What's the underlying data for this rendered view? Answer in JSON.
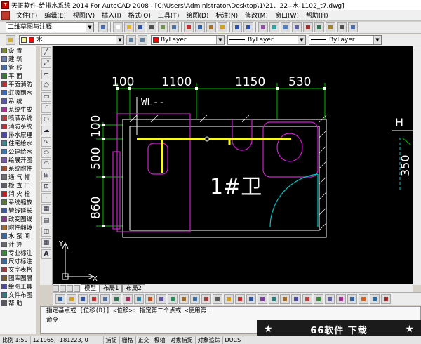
{
  "window": {
    "title": "天正软件-给排水系统 2014 For AutoCAD 2008 - [C:\\Users\\Administrator\\Desktop\\1\\21、22--水-1102_t7.dwg]"
  },
  "menu": [
    "文件(F)",
    "编辑(E)",
    "视图(V)",
    "插入(I)",
    "格式(O)",
    "工具(T)",
    "绘图(D)",
    "标注(N)",
    "修改(M)",
    "窗口(W)",
    "帮助(H)"
  ],
  "toolbar1": {
    "workspace": "二维草图与注释"
  },
  "toolbar2": {
    "layer": "水",
    "color": "ByLayer",
    "linetype": "ByLayer",
    "lineweight": "ByLayer",
    "layer_color": "#ff0000",
    "color_color": "#ff0000"
  },
  "left_menu": [
    {
      "label": "设    置",
      "color": "#7a8a2a"
    },
    {
      "label": "建    筑",
      "color": "#6b7fa8"
    },
    {
      "label": "管    线",
      "color": "#4a6aa8"
    },
    {
      "label": "平    面",
      "color": "#3a7a3a"
    },
    {
      "label": "平面消防",
      "color": "#c03030"
    },
    {
      "label": "虹吸雨水",
      "color": "#3a6ac0"
    },
    {
      "label": "系    统",
      "color": "#5a5ab0"
    },
    {
      "label": "系统生成",
      "color": "#b03090"
    },
    {
      "label": "喷洒系统",
      "color": "#c04040"
    },
    {
      "label": "消防系统",
      "color": "#c03030"
    },
    {
      "label": "排水原理",
      "color": "#4a4ab0"
    },
    {
      "label": "住宅给水",
      "color": "#3a8a8a"
    },
    {
      "label": "公建给水",
      "color": "#3a7ab0"
    },
    {
      "label": "绘展开图",
      "color": "#7a5ab0"
    },
    {
      "label": "系统附件",
      "color": "#a05030"
    },
    {
      "label": "通 气 帽",
      "color": "#707070"
    },
    {
      "label": "检 查 口",
      "color": "#606060"
    },
    {
      "label": "消 火 栓",
      "color": "#c02020"
    },
    {
      "label": "系统缩放",
      "color": "#5a7a3a"
    },
    {
      "label": "管线延长",
      "color": "#3a5aa0"
    },
    {
      "label": "改变图线",
      "color": "#8a3a8a"
    },
    {
      "label": "附件翻转",
      "color": "#a06a2a"
    },
    {
      "label": "水 泵 间",
      "color": "#3a6aa0"
    },
    {
      "label": "计    算",
      "color": "#6a6a6a"
    },
    {
      "label": "专业标注",
      "color": "#3a8a3a"
    },
    {
      "label": "尺寸标注",
      "color": "#3a6aa0"
    },
    {
      "label": "文字表格",
      "color": "#a03a3a"
    },
    {
      "label": "图库图层",
      "color": "#7a5a2a"
    },
    {
      "label": "绘图工具",
      "color": "#4a4aa0"
    },
    {
      "label": "文件布图",
      "color": "#3a7a7a"
    },
    {
      "label": "帮    助",
      "color": "#5a5a5a"
    }
  ],
  "drawing": {
    "dims_top": [
      "100",
      "1100",
      "1150",
      "530"
    ],
    "dims_left": [
      "100",
      "500",
      "860"
    ],
    "label_wl": "WL--",
    "room_label": "1#卫",
    "right_label_h": "H",
    "right_label_350": "350",
    "axis_x": "X",
    "axis_y": "Y"
  },
  "tabs": [
    "模型",
    "布局1",
    "布局2"
  ],
  "command": {
    "line1": "指定基点或 [位移(D)] <位移>:  指定第二个点或 <使用第一",
    "line2": "命令:"
  },
  "watermark": {
    "star": "★",
    "text": "66软件 下载"
  },
  "status": {
    "scale": "比例 1:50",
    "coords": "121965, -181223, 0",
    "toggles": [
      "捕捉",
      "栅格",
      "正交",
      "极轴",
      "对象捕捉",
      "对象追踪",
      "DUCS"
    ]
  }
}
